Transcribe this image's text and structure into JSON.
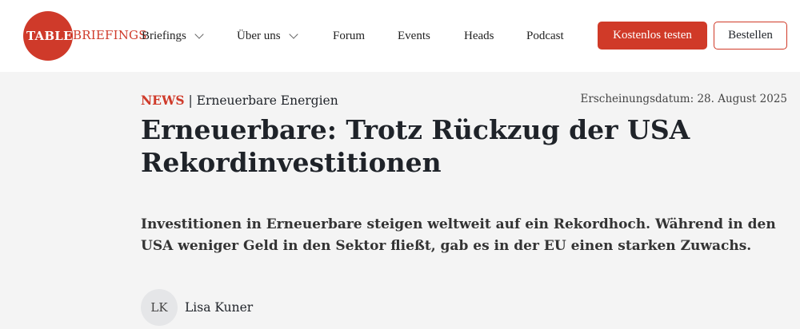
{
  "logo": {
    "table": "TABLE",
    "briefings": "BRIEFINGS"
  },
  "nav": {
    "items": [
      {
        "label": "Briefings"
      },
      {
        "label": "Über uns"
      },
      {
        "label": "Forum"
      },
      {
        "label": "Events"
      },
      {
        "label": "Heads"
      },
      {
        "label": "Podcast"
      }
    ]
  },
  "actions": {
    "trial_label": "Kostenlos testen",
    "order_label": "Bestellen"
  },
  "colors": {
    "brand": "#cf3a2a",
    "background": "#f4f4f4",
    "text": "#1f2329"
  },
  "article": {
    "kicker": "NEWS",
    "separator": " | ",
    "category": "Erneuerbare Energien",
    "date_label": "Erscheinungsdatum: 28. August 2025",
    "title": "Erneuerbare: Trotz Rückzug der USA Rekordinvestitionen",
    "lead": "Investitionen in Erneuerbare steigen weltweit auf ein Rekordhoch. Während in den USA weniger Geld in den Sektor fließt, gab es in der EU einen starken Zuwachs.",
    "author": {
      "initials": "LK",
      "name": "Lisa Kuner"
    }
  }
}
